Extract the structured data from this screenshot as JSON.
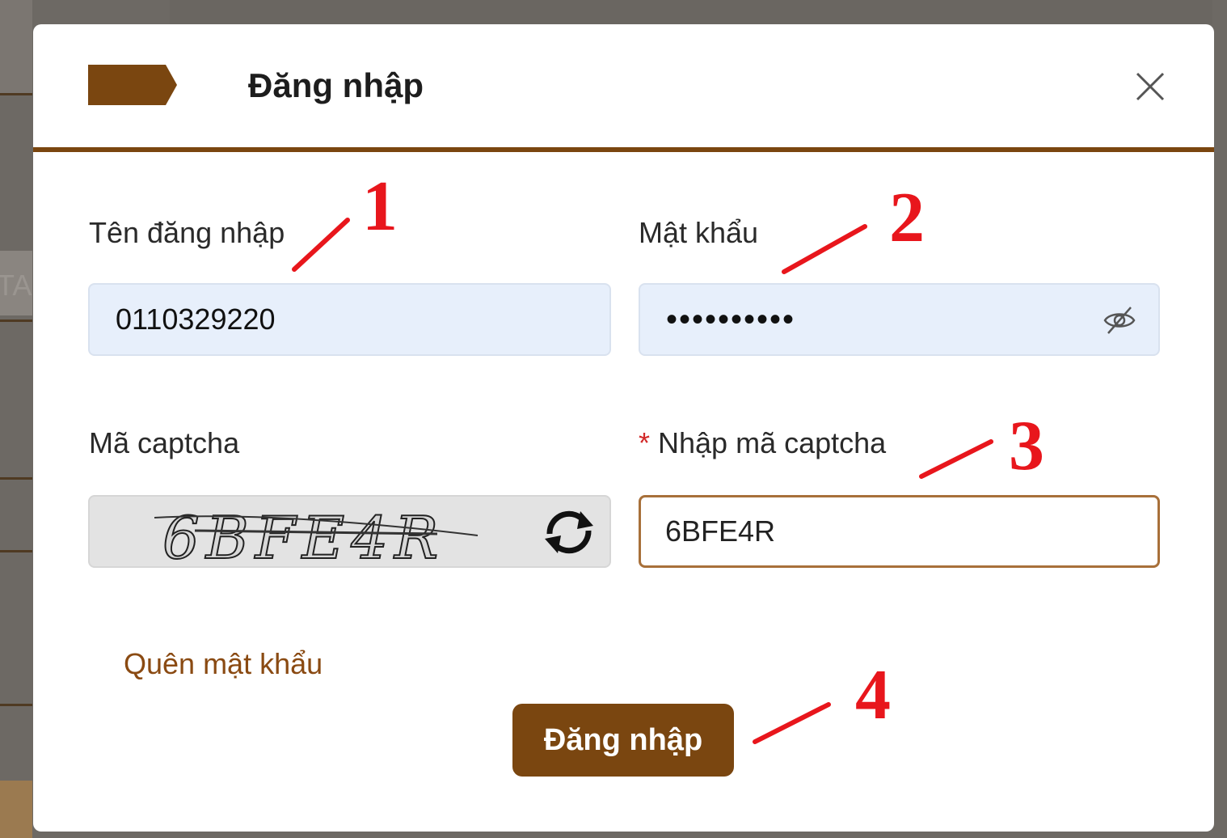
{
  "backdrop": {
    "partial_text": "TA"
  },
  "dialog": {
    "title": "Đăng nhập",
    "close_icon": "close-icon"
  },
  "form": {
    "username": {
      "label": "Tên đăng nhập",
      "value": "0110329220"
    },
    "password": {
      "label": "Mật khẩu",
      "value": "••••••••••",
      "toggle_icon": "eye-slash-icon"
    },
    "captcha": {
      "label": "Mã captcha",
      "image_text": "6BFE4R",
      "refresh_icon": "refresh-icon"
    },
    "captcha_input": {
      "required_mark": "*",
      "label": "Nhập mã captcha",
      "value": "6BFE4R"
    },
    "forgot_link": "Quên mật khẩu",
    "submit_label": "Đăng nhập"
  },
  "annotations": [
    "1",
    "2",
    "3",
    "4"
  ],
  "colors": {
    "brand": "#7a4610",
    "input_bg": "#e7effb",
    "annotation": "#e8161c"
  }
}
